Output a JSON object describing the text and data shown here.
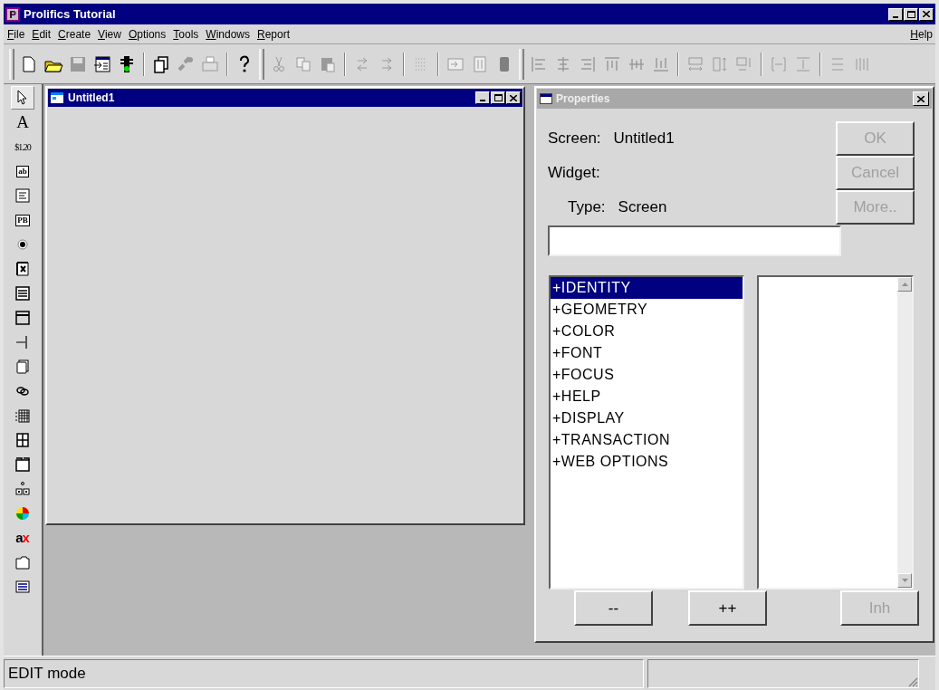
{
  "window": {
    "title": "Prolifics Tutorial"
  },
  "menu": [
    {
      "label": "File"
    },
    {
      "label": "Edit"
    },
    {
      "label": "Create"
    },
    {
      "label": "View"
    },
    {
      "label": "Options"
    },
    {
      "label": "Tools"
    },
    {
      "label": "Windows"
    },
    {
      "label": "Report"
    }
  ],
  "help_menu": {
    "label": "Help"
  },
  "palette": [
    {
      "kind": "pointer",
      "selected": true
    },
    {
      "kind": "glyph",
      "text": "A",
      "selected": false
    },
    {
      "kind": "glyph",
      "text": "$1.20",
      "selected": false
    },
    {
      "kind": "boxed",
      "text": "ab",
      "selected": false
    },
    {
      "kind": "lines",
      "selected": false
    },
    {
      "kind": "boxed",
      "text": "PB",
      "selected": false
    },
    {
      "kind": "radio",
      "selected": false
    },
    {
      "kind": "check",
      "selected": false
    },
    {
      "kind": "listbox",
      "selected": false
    },
    {
      "kind": "frame",
      "selected": false
    },
    {
      "kind": "line",
      "selected": false
    },
    {
      "kind": "copies",
      "selected": false
    },
    {
      "kind": "link",
      "selected": false
    },
    {
      "kind": "grid",
      "selected": false
    },
    {
      "kind": "split",
      "selected": false
    },
    {
      "kind": "tabs",
      "selected": false
    },
    {
      "kind": "tree",
      "selected": false
    },
    {
      "kind": "pie",
      "selected": false
    },
    {
      "kind": "accent",
      "text": "a",
      "accent": "x",
      "selected": false
    },
    {
      "kind": "folder",
      "selected": false
    },
    {
      "kind": "list",
      "selected": false
    }
  ],
  "screen_window": {
    "title": "Untitled1",
    "active": true
  },
  "properties": {
    "title": "Properties",
    "active": false,
    "screen_label": "Screen:",
    "screen_value": "Untitled1",
    "widget_label": "Widget:",
    "type_label": "Type:",
    "type_value": "Screen",
    "side_buttons": [
      {
        "label": "OK",
        "disabled": true
      },
      {
        "label": "Cancel",
        "disabled": true
      },
      {
        "label": "More..",
        "disabled": true
      }
    ],
    "categories": [
      {
        "label": "+IDENTITY",
        "selected": true
      },
      {
        "label": "+GEOMETRY",
        "selected": false
      },
      {
        "label": "+COLOR",
        "selected": false
      },
      {
        "label": "+FONT",
        "selected": false
      },
      {
        "label": "+FOCUS",
        "selected": false
      },
      {
        "label": "+HELP",
        "selected": false
      },
      {
        "label": "+DISPLAY",
        "selected": false
      },
      {
        "label": "+TRANSACTION",
        "selected": false
      },
      {
        "label": "+WEB OPTIONS",
        "selected": false
      }
    ],
    "bottom_buttons": [
      {
        "label": "--",
        "disabled": false
      },
      {
        "label": "++",
        "disabled": false
      },
      {
        "label": "Inh",
        "disabled": true
      }
    ]
  },
  "status_bar": {
    "mode": "EDIT mode"
  }
}
